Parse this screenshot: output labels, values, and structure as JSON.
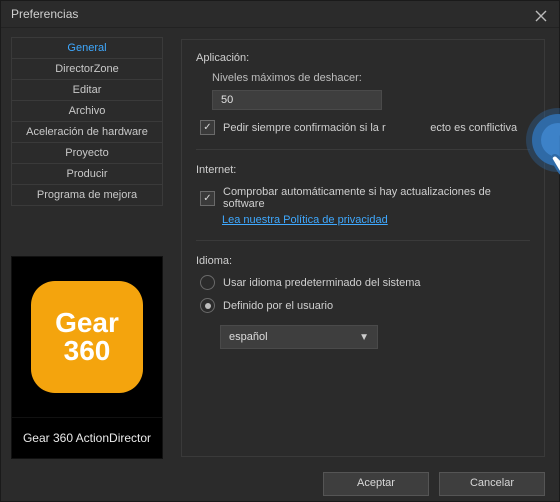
{
  "window": {
    "title": "Preferencias"
  },
  "sidebar": {
    "items": [
      {
        "label": "General",
        "active": true
      },
      {
        "label": "DirectorZone"
      },
      {
        "label": "Editar"
      },
      {
        "label": "Archivo"
      },
      {
        "label": "Aceleración de hardware"
      },
      {
        "label": "Proyecto"
      },
      {
        "label": "Producir"
      },
      {
        "label": "Programa de mejora"
      }
    ]
  },
  "promo": {
    "brand_top": "Gear",
    "brand_bottom": "360",
    "caption": "Gear 360 ActionDirector"
  },
  "app": {
    "section": "Aplicación:",
    "undo_label": "Niveles máximos de deshacer:",
    "undo_value": "50",
    "confirm_partial_before": "Pedir siempre confirmación si la r",
    "confirm_partial_after": "ecto es conflictiva"
  },
  "internet": {
    "section": "Internet:",
    "check_updates": "Comprobar automáticamente si hay actualizaciones de software",
    "privacy_link": "Lea nuestra Política de privacidad"
  },
  "language": {
    "section": "Idioma:",
    "option_default": "Usar idioma predeterminado del sistema",
    "option_user": "Definido por el usuario",
    "selected": "español"
  },
  "footer": {
    "ok": "Aceptar",
    "cancel": "Cancelar"
  },
  "icons": {
    "close": "close-icon",
    "caret": "chevron-down-icon",
    "tap": "tap-cursor-icon"
  }
}
